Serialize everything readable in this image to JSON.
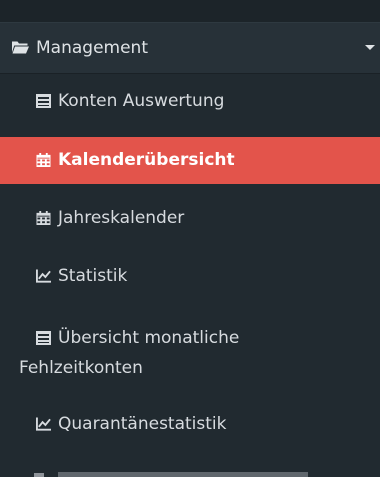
{
  "section": {
    "label": "Management",
    "icon": "folder-open-icon"
  },
  "menu": {
    "items": [
      {
        "label": "Konten Auswertung",
        "icon": "list-icon"
      },
      {
        "label": "Kalenderübersicht",
        "icon": "calendar-icon",
        "active": true
      },
      {
        "label": "Jahreskalender",
        "icon": "calendar-icon"
      },
      {
        "label": "Statistik",
        "icon": "line-chart-icon"
      },
      {
        "label_line1": "Übersicht monatliche",
        "label_line2": "Fehlzeitkonten",
        "icon": "list-icon"
      },
      {
        "label": "Quarantänestatistik",
        "icon": "line-chart-icon"
      }
    ]
  },
  "colors": {
    "background": "#212a30",
    "header": "#273138",
    "accent": "#e3544b",
    "text": "#d7dbdf"
  }
}
